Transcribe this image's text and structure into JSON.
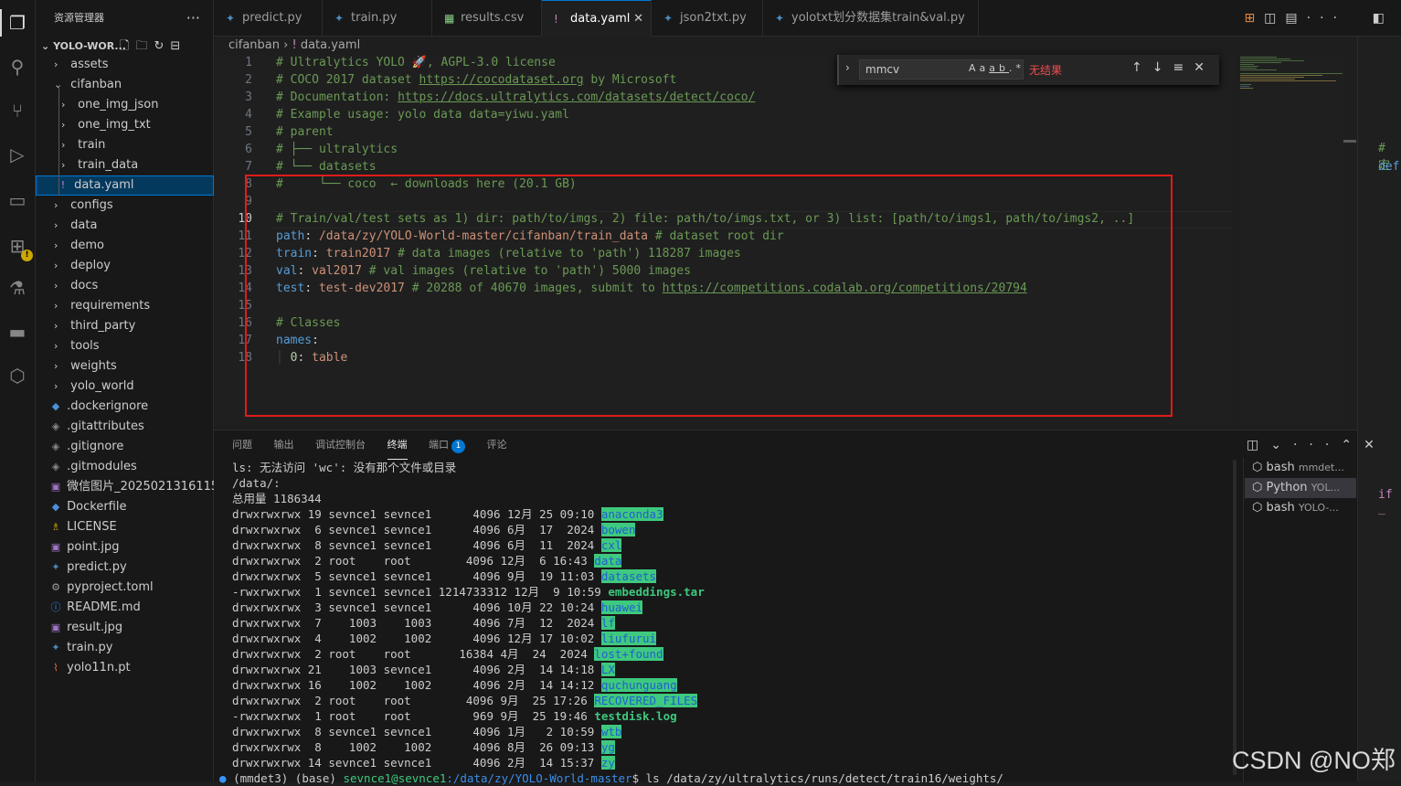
{
  "sidebar": {
    "title": "资源管理器",
    "workspace": "YOLO-WOR...",
    "items": [
      {
        "label": "assets",
        "kind": "folder",
        "depth": 1
      },
      {
        "label": "cifanban",
        "kind": "folder-open",
        "depth": 1
      },
      {
        "label": "one_img_json",
        "kind": "folder",
        "depth": 2
      },
      {
        "label": "one_img_txt",
        "kind": "folder",
        "depth": 2
      },
      {
        "label": "train",
        "kind": "folder",
        "depth": 2
      },
      {
        "label": "train_data",
        "kind": "folder",
        "depth": 2
      },
      {
        "label": "data.yaml",
        "kind": "yaml",
        "depth": 2
      },
      {
        "label": "configs",
        "kind": "folder",
        "depth": 1
      },
      {
        "label": "data",
        "kind": "folder",
        "depth": 1
      },
      {
        "label": "demo",
        "kind": "folder",
        "depth": 1
      },
      {
        "label": "deploy",
        "kind": "folder",
        "depth": 1
      },
      {
        "label": "docs",
        "kind": "folder",
        "depth": 1
      },
      {
        "label": "requirements",
        "kind": "folder",
        "depth": 1
      },
      {
        "label": "third_party",
        "kind": "folder",
        "depth": 1
      },
      {
        "label": "tools",
        "kind": "folder",
        "depth": 1
      },
      {
        "label": "weights",
        "kind": "folder",
        "depth": 1
      },
      {
        "label": "yolo_world",
        "kind": "folder",
        "depth": 1
      },
      {
        "label": ".dockerignore",
        "kind": "docker",
        "depth": 1
      },
      {
        "label": ".gitattributes",
        "kind": "git",
        "depth": 1
      },
      {
        "label": ".gitignore",
        "kind": "git",
        "depth": 1
      },
      {
        "label": ".gitmodules",
        "kind": "git",
        "depth": 1
      },
      {
        "label": "微信图片_2025021316115...",
        "kind": "image",
        "depth": 1
      },
      {
        "label": "Dockerfile",
        "kind": "docker",
        "depth": 1
      },
      {
        "label": "LICENSE",
        "kind": "license",
        "depth": 1
      },
      {
        "label": "point.jpg",
        "kind": "image",
        "depth": 1
      },
      {
        "label": "predict.py",
        "kind": "python",
        "depth": 1
      },
      {
        "label": "pyproject.toml",
        "kind": "toml",
        "depth": 1
      },
      {
        "label": "README.md",
        "kind": "info",
        "depth": 1
      },
      {
        "label": "result.jpg",
        "kind": "image",
        "depth": 1
      },
      {
        "label": "train.py",
        "kind": "python",
        "depth": 1
      },
      {
        "label": "yolo11n.pt",
        "kind": "rss",
        "depth": 1
      }
    ]
  },
  "tabs": [
    {
      "label": "predict.py",
      "icon": "python-icon",
      "icon_color": "#4b8bbe"
    },
    {
      "label": "train.py",
      "icon": "python-icon",
      "icon_color": "#4b8bbe"
    },
    {
      "label": "results.csv",
      "icon": "table-icon",
      "icon_color": "#89d185"
    },
    {
      "label": "data.yaml",
      "icon": "yaml-icon",
      "icon_color": "#c586c0"
    },
    {
      "label": "json2txt.py",
      "icon": "python-icon",
      "icon_color": "#4b8bbe"
    },
    {
      "label": "yolotxt划分数据集train&val.py",
      "icon": "python-icon",
      "icon_color": "#4b8bbe"
    }
  ],
  "breadcrumb": {
    "folder": "cifanban",
    "file": "data.yaml"
  },
  "find": {
    "value": "mmcv",
    "result": "无结果"
  },
  "code": {
    "line_numbers": [
      "1",
      "2",
      "3",
      "4",
      "5",
      "6",
      "7",
      "8",
      "9",
      "10",
      "11",
      "12",
      "13",
      "14",
      "15",
      "16",
      "17",
      "18"
    ],
    "l1": "# Ultralytics YOLO 🚀, AGPL-3.0 license",
    "l2a": "# COCO 2017 dataset ",
    "l2b": "https://cocodataset.org",
    "l2c": " by Microsoft",
    "l3a": "# Documentation: ",
    "l3b": "https://docs.ultralytics.com/datasets/detect/coco/",
    "l4": "# Example usage: yolo data data=yiwu.yaml",
    "l5": "# parent",
    "l6": "# ├── ultralytics",
    "l7": "# └── datasets",
    "l8": "#     └── coco  ← downloads here (20.1 GB)",
    "l10": "# Train/val/test sets as 1) dir: path/to/imgs, 2) file: path/to/imgs.txt, or 3) list: [path/to/imgs1, path/to/imgs2, ..]",
    "l11k": "path",
    "l11v": "/data/zy/YOLO-World-master/cifanban/train_data",
    "l11c": " # dataset root dir",
    "l12k": "train",
    "l12v": "train2017",
    "l12c": " # data images (relative to 'path') 118287 images",
    "l13k": "val",
    "l13v": "val2017",
    "l13c": " # val images (relative to 'path') 5000 images",
    "l14k": "test",
    "l14v": "test-dev2017",
    "l14c": " # 20288 of 40670 images, submit to ",
    "l14l": "https://competitions.codalab.org/competitions/20794",
    "l16": "# Classes",
    "l17k": "names",
    "l18k": "0",
    "l18v": "table"
  },
  "panel": {
    "tabs": [
      "问题",
      "输出",
      "调试控制台",
      "终端",
      "端口",
      "评论"
    ],
    "ports_badge": "1",
    "terminal_lines": [
      {
        "text": "ls: 无法访问 'wc': 没有那个文件或目录"
      },
      {
        "text": "/data/:"
      },
      {
        "text": "总用量 1186344"
      },
      {
        "text": "drwxrwxrwx 19 sevnce1 sevnce1      4096 12月 25 09:10 ",
        "name": "anaconda3",
        "type": "dir"
      },
      {
        "text": "drwxrwxrwx  6 sevnce1 sevnce1      4096 6月  17  2024 ",
        "name": "bowen",
        "type": "dir"
      },
      {
        "text": "drwxrwxrwx  8 sevnce1 sevnce1      4096 6月  11  2024 ",
        "name": "cxl",
        "type": "dir"
      },
      {
        "text": "drwxrwxrwx  2 root    root        4096 12月  6 16:43 ",
        "name": "data",
        "type": "dir"
      },
      {
        "text": "drwxrwxrwx  5 sevnce1 sevnce1      4096 9月  19 11:03 ",
        "name": "datasets",
        "type": "dir"
      },
      {
        "text": "-rwxrwxrwx  1 sevnce1 sevnce1 1214733312 12月  9 10:59 ",
        "name": "embeddings.tar",
        "type": "file"
      },
      {
        "text": "drwxrwxrwx  3 sevnce1 sevnce1      4096 10月 22 10:24 ",
        "name": "huawei",
        "type": "dir"
      },
      {
        "text": "drwxrwxrwx  7    1003    1003      4096 7月  12  2024 ",
        "name": "lf",
        "type": "dir"
      },
      {
        "text": "drwxrwxrwx  4    1002    1002      4096 12月 17 10:02 ",
        "name": "liufurui",
        "type": "dir"
      },
      {
        "text": "drwxrwxrwx  2 root    root       16384 4月  24  2024 ",
        "name": "lost+found",
        "type": "dir"
      },
      {
        "text": "drwxrwxrwx 21    1003 sevnce1      4096 2月  14 14:18 ",
        "name": "LX",
        "type": "dir"
      },
      {
        "text": "drwxrwxrwx 16    1002    1002      4096 2月  14 14:12 ",
        "name": "quchunguang",
        "type": "dir"
      },
      {
        "text": "drwxrwxrwx  2 root    root        4096 9月  25 17:26 ",
        "name": "RECOVERED_FILES",
        "type": "dir"
      },
      {
        "text": "-rwxrwxrwx  1 root    root         969 9月  25 19:46 ",
        "name": "testdisk.log",
        "type": "file"
      },
      {
        "text": "drwxrwxrwx  8 sevnce1 sevnce1      4096 1月   2 10:59 ",
        "name": "wtb",
        "type": "dir"
      },
      {
        "text": "drwxrwxrwx  8    1002    1002      4096 8月  26 09:13 ",
        "name": "yg",
        "type": "dir"
      },
      {
        "text": "drwxrwxrwx 14 sevnce1 sevnce1      4096 2月  14 15:37 ",
        "name": "zy",
        "type": "dir"
      }
    ],
    "prompt": {
      "env": "(mmdet3) (base) ",
      "user": "sevnce1@sevnce1",
      "path": ":/data/zy/YOLO-World-master",
      "cmd": "$ ls /data/zy/ultralytics/runs/detect/train16/weights/"
    },
    "terminals": [
      {
        "name": "bash",
        "sub": "mmdet..."
      },
      {
        "name": "Python",
        "sub": "YOL..."
      },
      {
        "name": "bash",
        "sub": "YOLO-..."
      }
    ]
  },
  "right_panel": {
    "snippet1": "# 定",
    "snippet2": "def",
    "snippet3": "if _"
  },
  "watermark": "CSDN @NO郑",
  "colors": {
    "accent": "#0078d4",
    "red_box": "#e01b1b",
    "dir_highlight": "#3ec97e"
  }
}
